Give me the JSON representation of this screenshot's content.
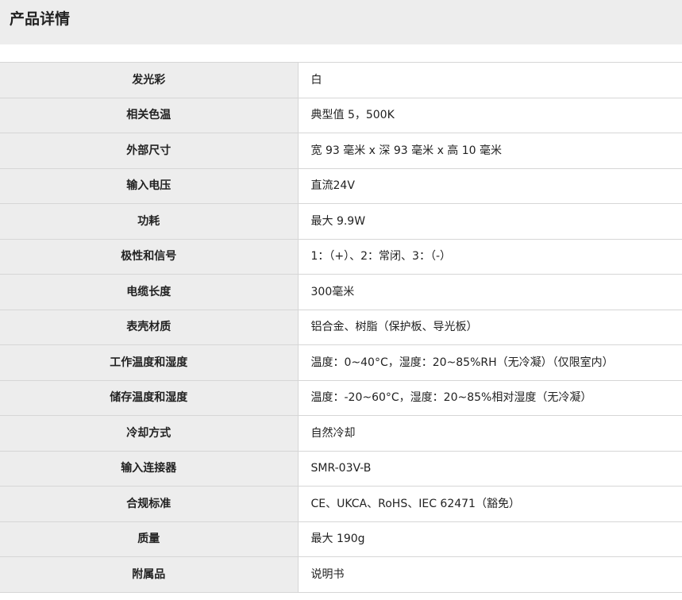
{
  "header": {
    "title": "产品详情"
  },
  "specs": [
    {
      "label": "发光彩",
      "value": "白"
    },
    {
      "label": "相关色温",
      "value": "典型值 5，500K"
    },
    {
      "label": "外部尺寸",
      "value": "宽 93 毫米 x 深 93 毫米 x 高 10 毫米"
    },
    {
      "label": "输入电压",
      "value": "直流24V"
    },
    {
      "label": "功耗",
      "value": "最大 9.9W"
    },
    {
      "label": "极性和信号",
      "value": "1：（+）、2：常闭、3：（-）"
    },
    {
      "label": "电缆长度",
      "value": "300毫米"
    },
    {
      "label": "表壳材质",
      "value": "铝合金、树脂（保护板、导光板）"
    },
    {
      "label": "工作温度和湿度",
      "value": "温度：0~40°C，湿度：20~85%RH（无冷凝）（仅限室内）"
    },
    {
      "label": "储存温度和湿度",
      "value": "温度：-20~60°C，湿度：20~85%相对湿度（无冷凝）"
    },
    {
      "label": "冷却方式",
      "value": "自然冷却"
    },
    {
      "label": "输入连接器",
      "value": "SMR-03V-B"
    },
    {
      "label": "合规标准",
      "value": "CE、UKCA、RoHS、IEC 62471（豁免）"
    },
    {
      "label": "质量",
      "value": "最大 190g"
    },
    {
      "label": "附属品",
      "value": "说明书"
    }
  ]
}
